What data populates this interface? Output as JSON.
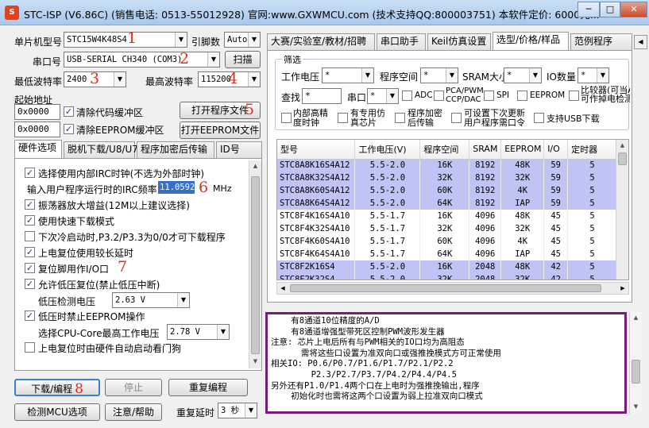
{
  "window": {
    "title": "STC-ISP (V6.86C) (销售电话: 0513-55012928) 官网:www.GXWMCU.com  (技术支持QQ:800003751) 本软件定价: 6000元...",
    "minimize": "─",
    "maximize": "□",
    "close": "✕"
  },
  "annotations": [
    "1",
    "2",
    "3",
    "4",
    "5",
    "6",
    "7",
    "8"
  ],
  "left": {
    "mcu_label": "单片机型号",
    "mcu_value": "STC15W4K48S4",
    "pins_label": "引脚数",
    "pins_value": "Auto",
    "port_label": "串口号",
    "port_value": "USB-SERIAL CH340 (COM3)",
    "scan_button": "扫描",
    "min_baud_label": "最低波特率",
    "min_baud_value": "2400",
    "max_baud_label": "最高波特率",
    "max_baud_value": "115200",
    "start_addr_label": "起始地址",
    "addr1": "0x0000",
    "clear_code_label": "清除代码缓冲区",
    "open_prog_button": "打开程序文件",
    "addr2": "0x0000",
    "clear_eeprom_label": "清除EEPROM缓冲区",
    "open_eeprom_button": "打开EEPROM文件"
  },
  "hw_tabs": [
    "硬件选项",
    "脱机下载/U8/U7",
    "程序加密后传输",
    "ID号"
  ],
  "hw_options": {
    "irc_label": "选择使用内部IRC时钟(不选为外部时钟)",
    "freq_label": "输入用户程序运行时的IRC频率",
    "freq_value": "11.0592",
    "freq_unit": "MHz",
    "amp_label": "振荡器放大增益(12M以上建议选择)",
    "fast_dl_label": "使用快速下载模式",
    "cold_label": "下次冷启动时,P3.2/P3.3为0/0才可下载程序",
    "long_reset_label": "上电复位使用较长延时",
    "reset_io_label": "复位脚用作I/O口",
    "lvr_label": "允许低压复位(禁止低压中断)",
    "lv_detect_label": "低压检测电压",
    "lv_detect_value": "2.63 V",
    "lv_eeprom_label": "低压时禁止EEPROM操作",
    "cpu_volt_label": "选择CPU-Core最高工作电压",
    "cpu_volt_value": "2.78 V",
    "watchdog_label": "上电复位时由硬件自动启动看门狗"
  },
  "bottom": {
    "download": "下载/编程",
    "stop": "停止",
    "reprogram": "重复编程",
    "check_mcu": "检测MCU选项",
    "help": "注意/帮助",
    "repeat_delay_label": "重复延时",
    "repeat_delay_value": "3 秒"
  },
  "right_tabs": [
    "大赛/实验室/教材/招聘",
    "串口助手",
    "Keil仿真设置",
    "选型/价格/样品",
    "范例程序"
  ],
  "filter": {
    "legend": "筛选",
    "voltage_label": "工作电压",
    "voltage_value": "*",
    "space_label": "程序空间",
    "space_value": "*",
    "sram_label": "SRAM大小",
    "sram_value": "*",
    "io_label": "IO数量",
    "io_value": "*",
    "compare_label": "比较器(可当ADC使用)",
    "find_label": "查找",
    "find_value": "*",
    "uart_label": "串口",
    "uart_value": "*",
    "adc_label": "ADC",
    "pca_label": "PCA/PWM CCP/DAC",
    "spi_label": "SPI",
    "eeprom_label": "EEPROM",
    "compare2_label": "可作掉电检测",
    "irc_label": "内部高精度时钟",
    "emu_label": "有专用仿真芯片",
    "encrypt_label": "程序加密后传输",
    "next_dl_label": "可设置下次更新用户程序需口令",
    "usb_label": "支持USB下载"
  },
  "table": {
    "columns": [
      "型号",
      "工作电压(V)",
      "程序空间",
      "SRAM",
      "EEPROM",
      "I/O",
      "定时器"
    ],
    "rows": [
      {
        "model": "STC8A8K16S4A12",
        "volt": "5.5-2.0",
        "space": "16K",
        "sram": "8192",
        "eeprom": "48K",
        "io": "59",
        "timer": "5",
        "hl": true
      },
      {
        "model": "STC8A8K32S4A12",
        "volt": "5.5-2.0",
        "space": "32K",
        "sram": "8192",
        "eeprom": "32K",
        "io": "59",
        "timer": "5",
        "hl": true
      },
      {
        "model": "STC8A8K60S4A12",
        "volt": "5.5-2.0",
        "space": "60K",
        "sram": "8192",
        "eeprom": "4K",
        "io": "59",
        "timer": "5",
        "hl": true
      },
      {
        "model": "STC8A8K64S4A12",
        "volt": "5.5-2.0",
        "space": "64K",
        "sram": "8192",
        "eeprom": "IAP",
        "io": "59",
        "timer": "5",
        "hl": true
      },
      {
        "model": "STC8F4K16S4A10",
        "volt": "5.5-1.7",
        "space": "16K",
        "sram": "4096",
        "eeprom": "48K",
        "io": "45",
        "timer": "5",
        "hl": false
      },
      {
        "model": "STC8F4K32S4A10",
        "volt": "5.5-1.7",
        "space": "32K",
        "sram": "4096",
        "eeprom": "32K",
        "io": "45",
        "timer": "5",
        "hl": false
      },
      {
        "model": "STC8F4K60S4A10",
        "volt": "5.5-1.7",
        "space": "60K",
        "sram": "4096",
        "eeprom": "4K",
        "io": "45",
        "timer": "5",
        "hl": false
      },
      {
        "model": "STC8F4K64S4A10",
        "volt": "5.5-1.7",
        "space": "64K",
        "sram": "4096",
        "eeprom": "IAP",
        "io": "45",
        "timer": "5",
        "hl": false
      },
      {
        "model": "STC8F2K16S4",
        "volt": "5.5-2.0",
        "space": "16K",
        "sram": "2048",
        "eeprom": "48K",
        "io": "42",
        "timer": "5",
        "hl": true
      },
      {
        "model": "STC8F2K32S4",
        "volt": "5.5-2.0",
        "space": "32K",
        "sram": "2048",
        "eeprom": "32K",
        "io": "42",
        "timer": "5",
        "hl": true
      }
    ]
  },
  "info_lines": [
    "    有8通道10位精度的A/D",
    "    有8通道增强型带死区控制PWM波形发生器",
    "",
    "注意: 芯片上电后所有与PWM相关的IO口均为高阻态",
    "      需将这些口设置为准双向口或强推挽模式方可正常使用",
    "相关IO: P0.6/P0.7/P1.6/P1.7/P2.1/P2.2",
    "        P2.3/P2.7/P3.7/P4.2/P4.4/P4.5",
    "另外还有P1.0/P1.4两个口在上电时为强推挽输出,程序",
    "    初始化时也需将这两个口设置为弱上拉准双向口模式"
  ]
}
